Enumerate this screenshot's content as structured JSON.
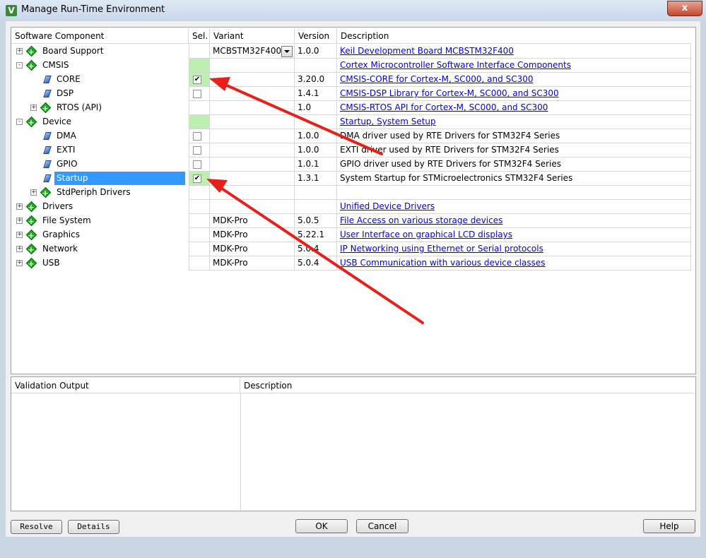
{
  "window": {
    "title": "Manage Run-Time Environment",
    "app_icon": "V",
    "close_label": "x"
  },
  "columns": {
    "component": "Software Component",
    "sel": "Sel.",
    "variant": "Variant",
    "version": "Version",
    "description": "Description"
  },
  "rows": [
    {
      "label": "Board Support",
      "icon": "green-diamond-icon",
      "expander": "+",
      "level": 0,
      "sel": "",
      "sel_green": false,
      "variant": "MCBSTM32F400",
      "variant_dropdown": true,
      "version": "1.0.0",
      "description": "Keil Development Board MCBSTM32F400",
      "desc_link": true
    },
    {
      "label": "CMSIS",
      "icon": "green-diamond-icon",
      "expander": "-",
      "level": 0,
      "sel": "",
      "sel_green": true,
      "variant": "",
      "variant_dropdown": false,
      "version": "",
      "description": "Cortex Microcontroller Software Interface Components",
      "desc_link": true
    },
    {
      "label": "CORE",
      "icon": "blue-gem-icon",
      "expander": "",
      "level": 1,
      "sel": "checked",
      "sel_green": true,
      "variant": "",
      "variant_dropdown": false,
      "version": "3.20.0",
      "description": "CMSIS-CORE for Cortex-M, SC000, and SC300",
      "desc_link": true
    },
    {
      "label": "DSP",
      "icon": "blue-gem-icon",
      "expander": "",
      "level": 1,
      "sel": "unchecked",
      "sel_green": false,
      "variant": "",
      "variant_dropdown": false,
      "version": "1.4.1",
      "description": "CMSIS-DSP Library for Cortex-M, SC000, and SC300",
      "desc_link": true
    },
    {
      "label": "RTOS (API)",
      "icon": "green-diamond-icon",
      "expander": "+",
      "level": 1,
      "sel": "",
      "sel_green": false,
      "variant": "",
      "variant_dropdown": false,
      "version": "1.0",
      "description": "CMSIS-RTOS API for Cortex-M, SC000, and SC300",
      "desc_link": true
    },
    {
      "label": "Device",
      "icon": "green-diamond-icon",
      "expander": "-",
      "level": 0,
      "sel": "",
      "sel_green": true,
      "variant": "",
      "variant_dropdown": false,
      "version": "",
      "description": "Startup, System Setup",
      "desc_link": true
    },
    {
      "label": "DMA",
      "icon": "blue-gem-icon",
      "expander": "",
      "level": 1,
      "sel": "unchecked",
      "sel_green": false,
      "variant": "",
      "variant_dropdown": false,
      "version": "1.0.0",
      "description": "DMA driver used by RTE Drivers for STM32F4 Series",
      "desc_link": false
    },
    {
      "label": "EXTI",
      "icon": "blue-gem-icon",
      "expander": "",
      "level": 1,
      "sel": "unchecked",
      "sel_green": false,
      "variant": "",
      "variant_dropdown": false,
      "version": "1.0.0",
      "description": "EXTI driver used by RTE Drivers for STM32F4 Series",
      "desc_link": false
    },
    {
      "label": "GPIO",
      "icon": "blue-gem-icon",
      "expander": "",
      "level": 1,
      "sel": "unchecked",
      "sel_green": false,
      "variant": "",
      "variant_dropdown": false,
      "version": "1.0.1",
      "description": "GPIO driver used by RTE Drivers for STM32F4 Series",
      "desc_link": false
    },
    {
      "label": "Startup",
      "icon": "blue-gem-icon",
      "expander": "",
      "level": 1,
      "selected": true,
      "sel": "checked",
      "sel_green": true,
      "variant": "",
      "variant_dropdown": false,
      "version": "1.3.1",
      "description": "System Startup for STMicroelectronics STM32F4 Series",
      "desc_link": false
    },
    {
      "label": "StdPeriph Drivers",
      "icon": "green-diamond-icon",
      "expander": "+",
      "level": 1,
      "sel": "",
      "sel_green": false,
      "variant": "",
      "variant_dropdown": false,
      "version": "",
      "description": "",
      "desc_link": false
    },
    {
      "label": "Drivers",
      "icon": "green-diamond-icon",
      "expander": "+",
      "level": 0,
      "sel": "",
      "sel_green": false,
      "variant": "",
      "variant_dropdown": false,
      "version": "",
      "description": "Unified Device Drivers",
      "desc_link": true
    },
    {
      "label": "File System",
      "icon": "green-diamond-icon",
      "expander": "+",
      "level": 0,
      "sel": "",
      "sel_green": false,
      "variant": "MDK-Pro",
      "variant_dropdown": false,
      "version": "5.0.5",
      "description": "File Access on various storage devices",
      "desc_link": true
    },
    {
      "label": "Graphics",
      "icon": "green-diamond-icon",
      "expander": "+",
      "level": 0,
      "sel": "",
      "sel_green": false,
      "variant": "MDK-Pro",
      "variant_dropdown": false,
      "version": "5.22.1",
      "description": "User Interface on graphical LCD displays",
      "desc_link": true
    },
    {
      "label": "Network",
      "icon": "green-diamond-icon",
      "expander": "+",
      "level": 0,
      "sel": "",
      "sel_green": false,
      "variant": "MDK-Pro",
      "variant_dropdown": false,
      "version": "5.0.4",
      "description": "IP Networking using Ethernet or Serial protocols",
      "desc_link": true
    },
    {
      "label": "USB",
      "icon": "green-diamond-icon",
      "expander": "+",
      "level": 0,
      "sel": "",
      "sel_green": false,
      "variant": "MDK-Pro",
      "variant_dropdown": false,
      "version": "5.0.4",
      "description": "USB Communication with various device classes",
      "desc_link": true
    }
  ],
  "validation": {
    "output_header": "Validation Output",
    "description_header": "Description"
  },
  "buttons": {
    "resolve": "Resolve",
    "details": "Details",
    "ok": "OK",
    "cancel": "Cancel",
    "help": "Help"
  },
  "annotation_color": "#e8201a"
}
